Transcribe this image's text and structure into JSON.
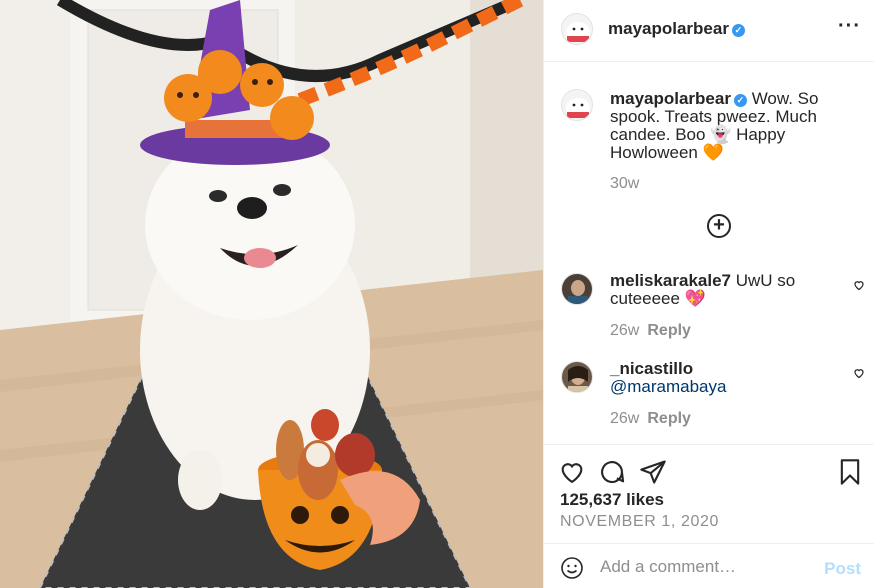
{
  "post": {
    "username": "mayapolarbear",
    "verified": true,
    "more_icon": "more-options-icon",
    "photo_alt": "photo"
  },
  "caption": {
    "username": "mayapolarbear",
    "text": "Wow. So spook. Treats pweez. Much candee. Boo 👻 Happy Howloween 🧡",
    "time": "30w"
  },
  "load_more_icon": "plus-circle-icon",
  "comments": [
    {
      "username": "meliskarakale7",
      "text": "UwU so cuteeeee 💖",
      "time": "26w",
      "reply": "Reply"
    },
    {
      "username": "_nicastillo",
      "mention": "@maramabaya",
      "time": "26w",
      "reply": "Reply"
    }
  ],
  "actions": {
    "like_icon": "heart-icon",
    "comment_icon": "comment-bubble-icon",
    "share_icon": "paper-plane-icon",
    "save_icon": "bookmark-icon"
  },
  "likes": "125,637 likes",
  "date": "NOVEMBER 1, 2020",
  "add_comment": {
    "placeholder": "Add a comment…",
    "post_label": "Post",
    "emoji_icon": "emoji-smiley-icon"
  },
  "colors": {
    "text": "#262626",
    "muted": "#8e8e8e",
    "verified": "#3897f0",
    "post_disabled": "#b2dffc",
    "mention": "#00376b"
  }
}
